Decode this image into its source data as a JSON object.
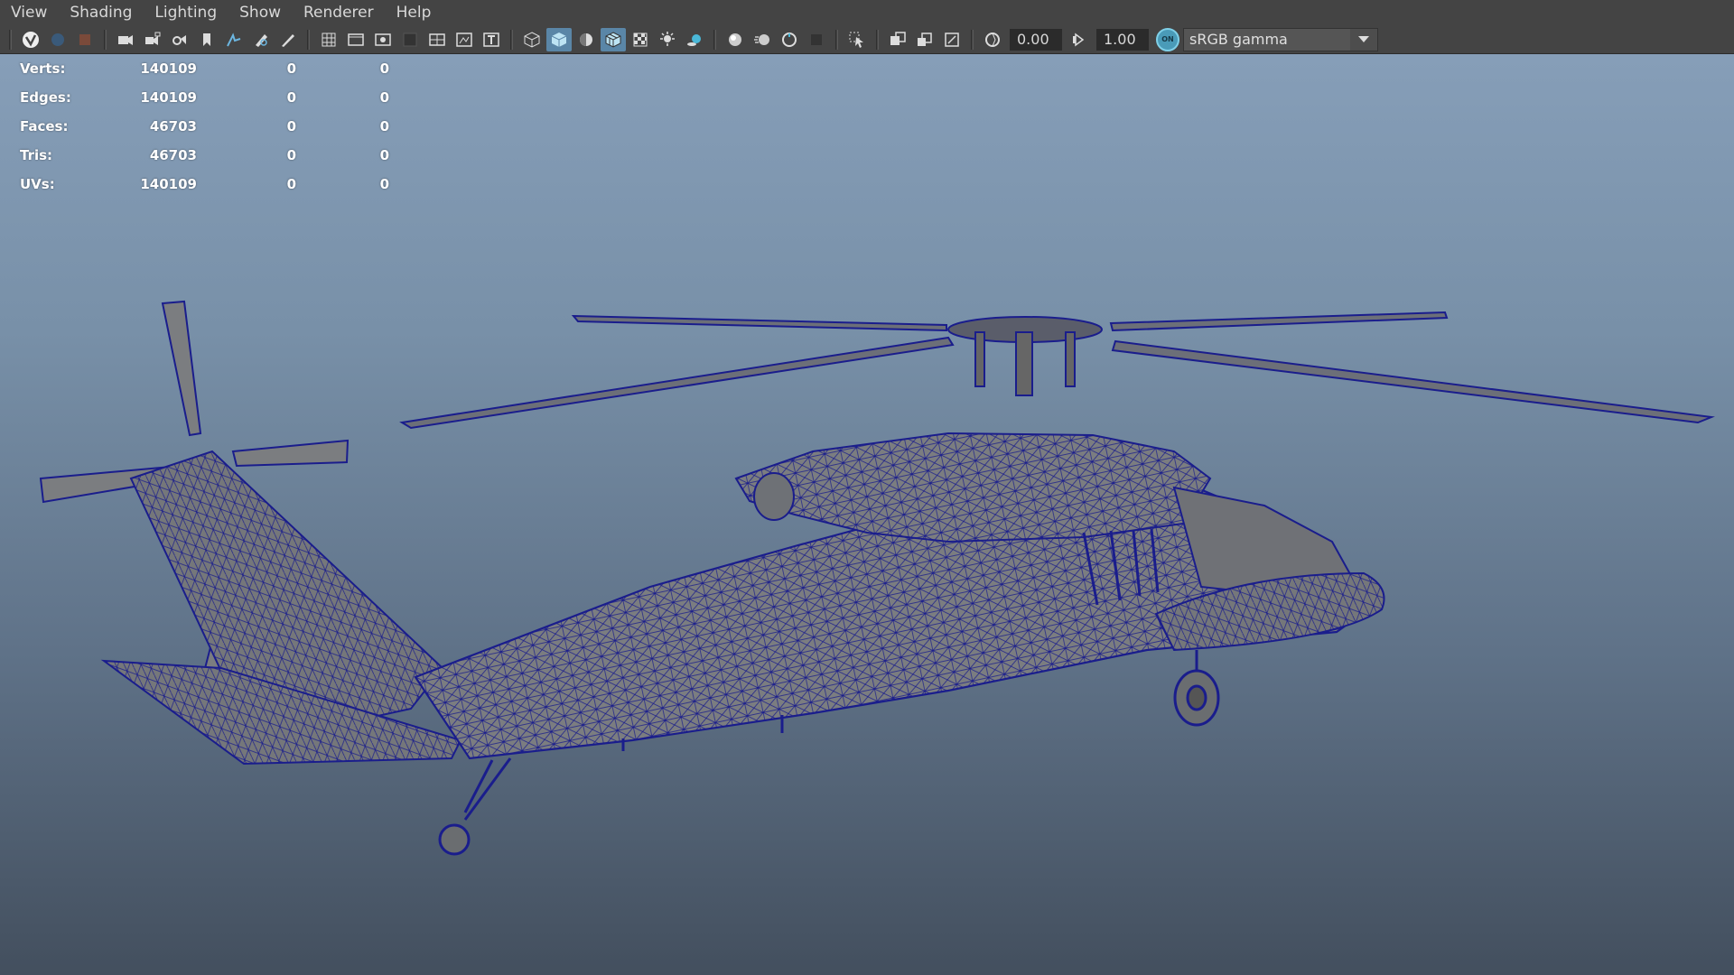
{
  "menu": [
    "View",
    "Shading",
    "Lighting",
    "Show",
    "Renderer",
    "Help"
  ],
  "toolbar": {
    "exposure_value": "0.00",
    "gamma_value": "1.00",
    "color_mgmt_toggle": "ON",
    "color_space": "sRGB gamma"
  },
  "hud": {
    "rows": [
      {
        "label": "Verts:",
        "total": "140109",
        "selected": "0",
        "other": "0"
      },
      {
        "label": "Edges:",
        "total": "140109",
        "selected": "0",
        "other": "0"
      },
      {
        "label": "Faces:",
        "total": "46703",
        "selected": "0",
        "other": "0"
      },
      {
        "label": "Tris:",
        "total": "46703",
        "selected": "0",
        "other": "0"
      },
      {
        "label": "UVs:",
        "total": "140109",
        "selected": "0",
        "other": "0"
      }
    ]
  },
  "colors": {
    "wireframe": "#1a1d8c",
    "mesh_fill": "#7b7d80",
    "active_button": "#5a86a7",
    "bg_top": "#869eb8",
    "bg_bottom": "#434f5e"
  }
}
